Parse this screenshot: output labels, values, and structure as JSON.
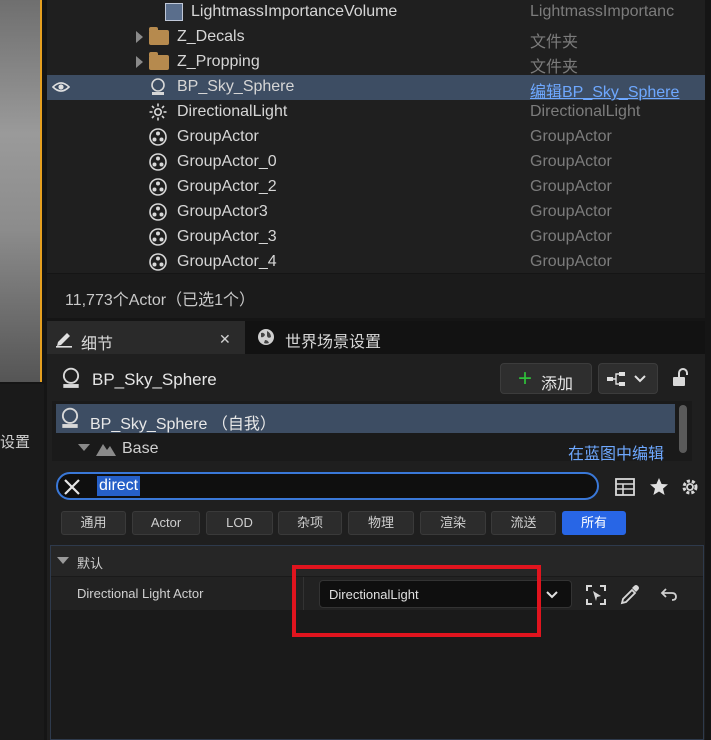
{
  "viewport": {
    "label": "设置"
  },
  "outliner": {
    "rows": [
      {
        "name": "LightmassImportanceVolume",
        "type": "LightmassImportanc",
        "icon": "volume-icon"
      },
      {
        "name": "Z_Decals",
        "type": "文件夹",
        "icon": "folder-icon"
      },
      {
        "name": "Z_Propping",
        "type": "文件夹",
        "icon": "folder-icon"
      },
      {
        "name": "BP_Sky_Sphere",
        "type": "编辑BP_Sky_Sphere",
        "icon": "sky-sphere-icon"
      },
      {
        "name": "DirectionalLight",
        "type": "DirectionalLight",
        "icon": "sun-icon"
      },
      {
        "name": "GroupActor",
        "type": "GroupActor",
        "icon": "group-actor-icon"
      },
      {
        "name": "GroupActor_0",
        "type": "GroupActor",
        "icon": "group-actor-icon"
      },
      {
        "name": "GroupActor_2",
        "type": "GroupActor",
        "icon": "group-actor-icon"
      },
      {
        "name": "GroupActor3",
        "type": "GroupActor",
        "icon": "group-actor-icon"
      },
      {
        "name": "GroupActor_3",
        "type": "GroupActor",
        "icon": "group-actor-icon"
      },
      {
        "name": "GroupActor_4",
        "type": "GroupActor",
        "icon": "group-actor-icon"
      }
    ],
    "footer": "11,773个Actor（已选1个）"
  },
  "tabs": {
    "details": "细节",
    "world": "世界场景设置",
    "close_glyph": "✕"
  },
  "details": {
    "actor_name": "BP_Sky_Sphere",
    "add_label": "添加",
    "add_glyph": "+",
    "component_self": "BP_Sky_Sphere （自我）",
    "component_base": "Base",
    "edit_in_blueprint": "在蓝图中编辑",
    "search_value": "direct",
    "filters": [
      "通用",
      "Actor",
      "LOD",
      "杂项",
      "物理",
      "渲染",
      "流送",
      "所有"
    ],
    "active_filter": "所有",
    "category": "默认",
    "property_label": "Directional Light Actor",
    "property_value": "DirectionalLight"
  },
  "colors": {
    "accent_blue": "#2866e6",
    "selection": "#3d4d63",
    "highlight_box": "#e0141e",
    "viewport_border": "#e6a020"
  }
}
